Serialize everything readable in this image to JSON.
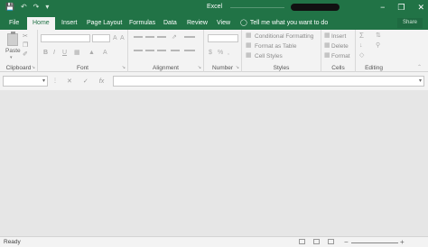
{
  "titlebar": {
    "title": "Excel",
    "qat": {
      "save_icon": "save-icon",
      "undo_icon": "undo-icon",
      "redo_icon": "redo-icon",
      "customize_icon": "chevron-down-icon"
    },
    "window_controls": [
      "−",
      "❐",
      "✕"
    ]
  },
  "tabs": [
    {
      "label": "File",
      "active": false
    },
    {
      "label": "Home",
      "active": true
    },
    {
      "label": "Insert",
      "active": false
    },
    {
      "label": "Page Layout",
      "active": false
    },
    {
      "label": "Formulas",
      "active": false
    },
    {
      "label": "Data",
      "active": false
    },
    {
      "label": "Review",
      "active": false
    },
    {
      "label": "View",
      "active": false
    }
  ],
  "tell_me": {
    "icon": "lightbulb-icon",
    "text": "Tell me what you want to do"
  },
  "share": {
    "label": "Share"
  },
  "ribbon": {
    "clipboard": {
      "label": "Clipboard",
      "paste_label": "Paste"
    },
    "font": {
      "label": "Font",
      "bold": "B",
      "italic": "I",
      "underline": "U"
    },
    "alignment": {
      "label": "Alignment"
    },
    "number": {
      "label": "Number",
      "currency": "$",
      "percent": "%",
      "comma": ","
    },
    "styles": {
      "label": "Styles",
      "conditional_formatting": "Conditional Formatting",
      "format_as_table": "Format as Table",
      "cell_styles": "Cell Styles"
    },
    "cells": {
      "label": "Cells",
      "insert": "Insert",
      "delete": "Delete",
      "format": "Format"
    },
    "editing": {
      "label": "Editing",
      "sum": "Σ"
    }
  },
  "formula_bar": {
    "cancel": "✕",
    "enter": "✓",
    "fx": "fx"
  },
  "status": {
    "text": "Ready"
  },
  "colors": {
    "brand": "#217346",
    "ribbon_bg": "#f3f3f3",
    "workspace_bg": "#e6e6e6"
  }
}
